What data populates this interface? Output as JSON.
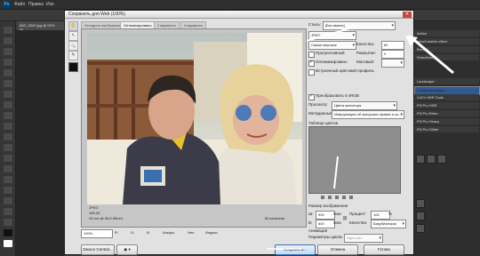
{
  "app": {
    "logo": "Ps",
    "menus": [
      "Файл",
      "Правка",
      "Изо"
    ],
    "doc_tab": "IMG_9262.jpg @ 50% (R..."
  },
  "right_panel": {
    "items": [
      {
        "label": "Action"
      },
      {
        "label": "pencil sketch effect"
      },
      {
        "label": "Reveal"
      },
      {
        "label": "Smoothes"
      },
      {
        "label": "Landscape"
      },
      {
        "label": "Landscape action",
        "selected": true
      },
      {
        "label": "CoFe HDR Tools"
      },
      {
        "label": "FN Pro HDR"
      },
      {
        "label": "FN Pro Retro"
      },
      {
        "label": "FN Pro Heavy"
      },
      {
        "label": "FN Pro Glider"
      }
    ]
  },
  "dialog": {
    "title": "Сохранить для Web (100%)",
    "close_glyph": "✕",
    "tabs": [
      "Исходное изображение",
      "Оптимизировано",
      "2 варианта",
      "4 варианта"
    ],
    "active_tab": 1,
    "tools": [
      {
        "name": "hand-tool",
        "glyph": "✋"
      },
      {
        "name": "slice-select-tool",
        "glyph": "↖"
      },
      {
        "name": "zoom-tool",
        "glyph": "🔍"
      },
      {
        "name": "eyedropper-tool",
        "glyph": "✎"
      }
    ],
    "preview_info": {
      "format": "JPEG",
      "size": "155,2K",
      "time": "43 сек @ 56,6 Кбит/с",
      "quality": "80 качество"
    },
    "settings": {
      "preset_label": "Стиль:",
      "preset_value": "[Без имени]",
      "format_value": "JPEG",
      "quality_preset": "Самое высокое",
      "quality_label": "Качество:",
      "quality_value": "80",
      "progressive_label": "Прогрессивный",
      "progressive_checked": false,
      "blur_label": "Размытие:",
      "blur_value": "0",
      "optimized_label": "Оптимизировано",
      "optimized_checked": true,
      "matte_label": "Матовый:",
      "embed_profile_label": "Встроенный цветовой профиль",
      "embed_profile_checked": false,
      "convert_srgb_label": "Преобразовать в sRGB",
      "convert_srgb_checked": true,
      "preview_label": "Просмотр:",
      "preview_value": "Цвета монитора",
      "metadata_label": "Метаданные:",
      "metadata_value": "Информация об авторских правах и ко...",
      "color_table_label": "Таблица цветов",
      "image_size_label": "Размер изображения",
      "width_label": "Ш:",
      "width_value": "900",
      "height_label": "В:",
      "height_value": "600",
      "px_unit": "пикс",
      "percent_label": "Процент:",
      "percent_value": "100",
      "percent_unit": "%",
      "quality_resample_label": "Качество:",
      "quality_resample_value": "Бикубическая",
      "animation_label": "Анимация",
      "loop_label": "Параметры цикла:",
      "loop_value": "Один раз"
    },
    "bottom_bar": {
      "zoom": "100%",
      "r_label": "R:",
      "g_label": "G:",
      "b_label": "B:",
      "alpha_label": "Альфа:",
      "hex_label": "Hex:",
      "index_label": "Индекс:"
    },
    "buttons": {
      "device_central": "Device Central...",
      "preview_in_browser": "Просмотр...",
      "save": "Сохранить...",
      "cancel": "Отмена",
      "done": "Готово"
    }
  },
  "colors": {
    "dialog_bg": "#e1e1e1",
    "ps_bg": "#3c3c3c",
    "selection": "#2f5b93",
    "close": "#c9463d"
  }
}
